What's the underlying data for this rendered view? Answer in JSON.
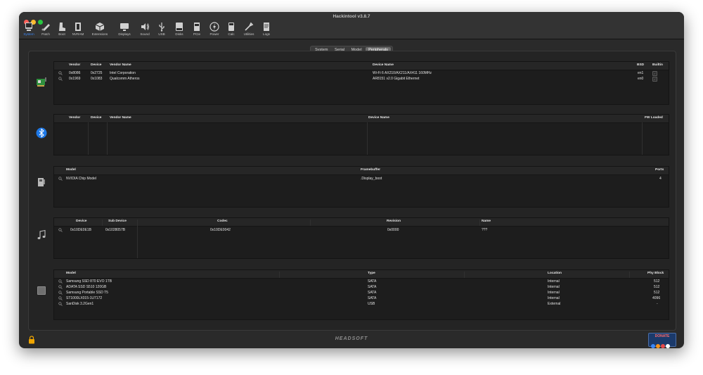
{
  "window": {
    "title": "Hackintool v3.8.7"
  },
  "toolbar": {
    "items": [
      {
        "label": "System",
        "icon": "system-icon",
        "selected": true
      },
      {
        "label": "Patch",
        "icon": "patch-icon"
      },
      {
        "label": "Boot",
        "icon": "boot-icon"
      },
      {
        "label": "NVRAM",
        "icon": "nvram-icon"
      },
      {
        "label": "Extensions",
        "icon": "extensions-icon"
      },
      {
        "label": "Displays",
        "icon": "displays-icon"
      },
      {
        "label": "Sound",
        "icon": "sound-icon"
      },
      {
        "label": "USB",
        "icon": "usb-icon"
      },
      {
        "label": "Disks",
        "icon": "disks-icon"
      },
      {
        "label": "PCIe",
        "icon": "pcie-icon"
      },
      {
        "label": "Power",
        "icon": "power-icon"
      },
      {
        "label": "Calc",
        "icon": "calc-icon"
      },
      {
        "label": "Utilities",
        "icon": "utilities-icon"
      },
      {
        "label": "Logs",
        "icon": "logs-icon"
      }
    ]
  },
  "tabs": [
    {
      "label": "System"
    },
    {
      "label": "Serial"
    },
    {
      "label": "Model"
    },
    {
      "label": "Peripherals",
      "active": true
    }
  ],
  "network": {
    "headers": {
      "vendor": "Vendor",
      "device": "Device",
      "vendor_name": "Vendor Name",
      "device_name": "Device Name",
      "bsd": "BSD",
      "builtin": "Builtin"
    },
    "rows": [
      {
        "vendor": "0x8086",
        "device": "0x2725",
        "vendor_name": "Intel Corporation",
        "device_name": "Wi-Fi 6 AX210/AX211/AX411 160MHz",
        "bsd": "en1",
        "builtin": "✓"
      },
      {
        "vendor": "0x1969",
        "device": "0x1083",
        "vendor_name": "Qualcomm Atheros",
        "device_name": "AR8151 v2.0 Gigabit Ethernet",
        "bsd": "en0",
        "builtin": "✓"
      }
    ]
  },
  "bluetooth": {
    "headers": {
      "vendor": "Vendor",
      "device": "Device",
      "vendor_name": "Vendor Name",
      "device_name": "Device Name",
      "fw_loaded": "FW Loaded"
    }
  },
  "graphics": {
    "headers": {
      "model": "Model",
      "framebuffer": "Framebuffer",
      "ports": "Ports"
    },
    "rows": [
      {
        "model": "NVIDIA Chip Model",
        "framebuffer": ".Display_boot",
        "ports": "4"
      }
    ]
  },
  "audio": {
    "headers": {
      "device": "Device",
      "sub_device": "Sub Device",
      "codec": "Codec",
      "revision": "Revision",
      "name": "Name"
    },
    "rows": [
      {
        "device": "0x10DE0E1B",
        "sub_device": "0x1028057B",
        "codec": "0x10DE0042",
        "revision": "0x0000",
        "name": "???"
      }
    ]
  },
  "storage": {
    "headers": {
      "model": "Model",
      "type": "Type",
      "location": "Location",
      "phy_block": "Phy Block"
    },
    "rows": [
      {
        "model": "Samsung SSD 870 EVO 1TB",
        "type": "SATA",
        "location": "Internal",
        "phy_block": "512"
      },
      {
        "model": "ADATA SSD S510 120GB",
        "type": "SATA",
        "location": "Internal",
        "phy_block": "512"
      },
      {
        "model": "Samsung Portable SSD T5",
        "type": "SATA",
        "location": "Internal",
        "phy_block": "512"
      },
      {
        "model": "ST1000LX015-1U7172",
        "type": "SATA",
        "location": "Internal",
        "phy_block": "4096"
      },
      {
        "model": "SanDisk 3.2Gen1",
        "type": "USB",
        "location": "External",
        "phy_block": "-"
      }
    ]
  },
  "footer": {
    "brand": "HEADSOFT",
    "donate_label": "DONATE"
  },
  "colors": {
    "accent": "#3b87f7",
    "close": "#ff5f57",
    "minimize": "#febc2e",
    "zoom": "#28c840"
  }
}
